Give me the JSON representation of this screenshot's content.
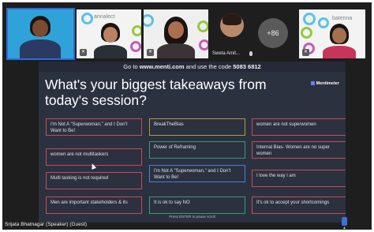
{
  "participants": {
    "tile2_watermark": "annalect",
    "tile5_watermark": "batenna",
    "tile4_name": "Sweta Amit...",
    "more_count": "+86"
  },
  "presentation": {
    "code_prefix": "Go to ",
    "code_url": "www.menti.com",
    "code_middle": " and use the code ",
    "code": "5083 6812",
    "question": "What's your biggest takeaways from today's session?",
    "brand": "Mentimeter",
    "responses": [
      "I'm Not A \"Superwoman,\" and I Don't Want to Be!",
      "BreakTheBias",
      "women are not superwomen",
      "women are not multitaskers",
      "Power of Reframing",
      "Internal Bias- Women are no super women",
      "Multi tasking is not required",
      "I'm Not A \"Superwoman,\" and I Don't Want to Be!",
      "I love the way i am",
      "Men are important stakeholders & its",
      "It is ok to say NO",
      "It's ok to accept your shortcomings"
    ],
    "enter_hint": "Press ENTER to pause scroll"
  },
  "speaker_label": "Srijata Bhatnagar (Speaker) (Guest)",
  "colors": {
    "card_red": "#c84a5a",
    "card_green": "#2e9e7a",
    "card_blue": "#4b7fd6",
    "card_yellow": "#b49a3c",
    "slide_bg": "#2c3140"
  }
}
